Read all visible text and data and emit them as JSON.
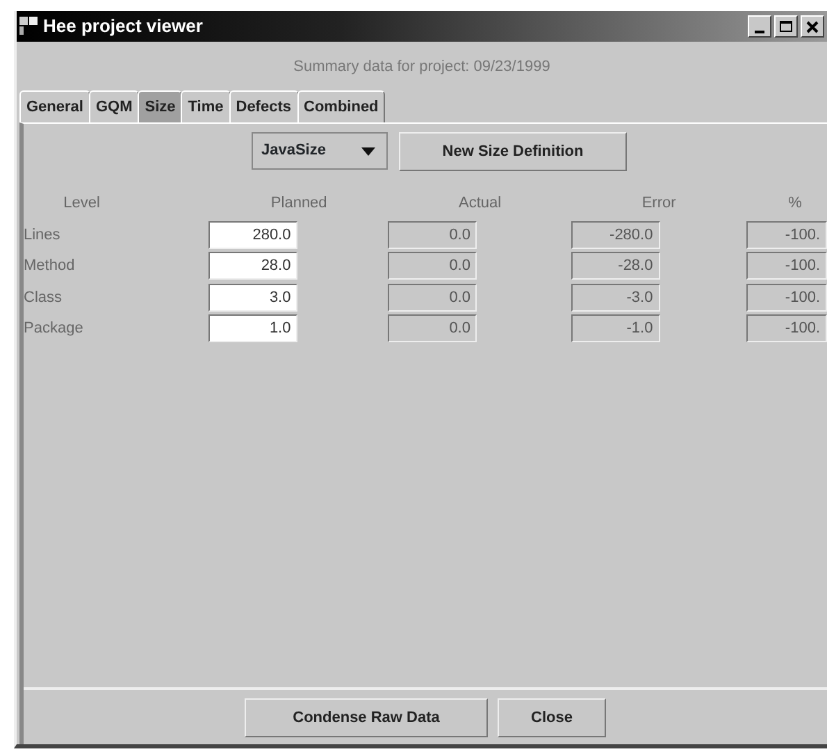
{
  "window": {
    "title": "Hee project viewer"
  },
  "summary": "Summary data for project: 09/23/1999",
  "tabs": [
    {
      "label": "General",
      "selected": false
    },
    {
      "label": "GQM",
      "selected": false
    },
    {
      "label": "Size",
      "selected": true
    },
    {
      "label": "Time",
      "selected": false
    },
    {
      "label": "Defects",
      "selected": false
    },
    {
      "label": "Combined",
      "selected": false
    }
  ],
  "size_definition": {
    "value": "JavaSize"
  },
  "new_button": "New Size Definition",
  "columns": [
    "Level",
    "Planned",
    "Actual",
    "Error",
    "%"
  ],
  "rows": [
    {
      "level": "Lines",
      "planned": "280.0",
      "actual": "0.0",
      "error": "-280.0",
      "percent": "-100."
    },
    {
      "level": "Method",
      "planned": "28.0",
      "actual": "0.0",
      "error": "-28.0",
      "percent": "-100."
    },
    {
      "level": "Class",
      "planned": "3.0",
      "actual": "0.0",
      "error": "-3.0",
      "percent": "-100."
    },
    {
      "level": "Package",
      "planned": "1.0",
      "actual": "0.0",
      "error": "-1.0",
      "percent": "-100."
    }
  ],
  "buttons": [
    "Condense Raw Data",
    "Close"
  ]
}
